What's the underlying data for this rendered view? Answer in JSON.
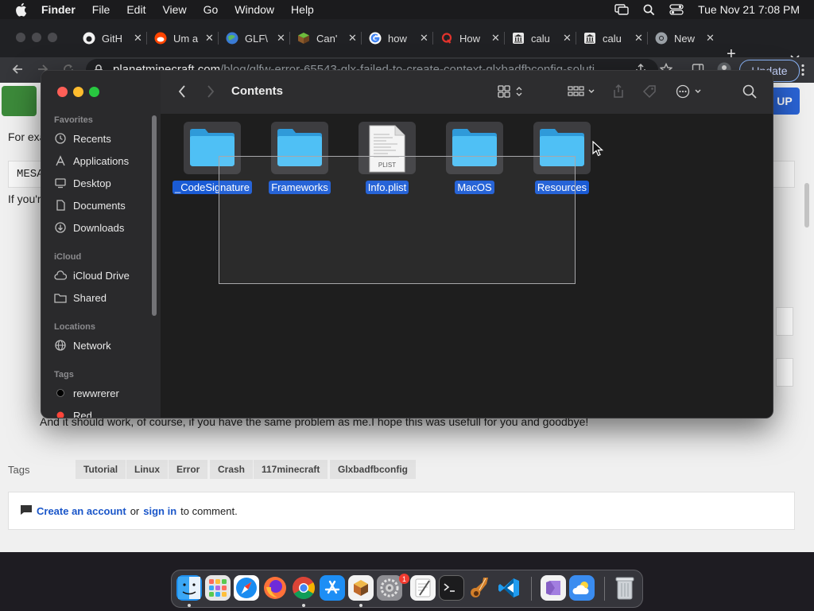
{
  "menubar": {
    "app_name": "Finder",
    "menus": [
      "File",
      "Edit",
      "View",
      "Go",
      "Window",
      "Help"
    ],
    "clock": "Tue Nov 21  7:08 PM"
  },
  "browser": {
    "tabs": [
      {
        "label": "GitH",
        "icon": "github-icon"
      },
      {
        "label": "Um a",
        "icon": "reddit-icon"
      },
      {
        "label": "GLF\\",
        "icon": "globe-icon"
      },
      {
        "label": "Can'",
        "icon": "minecraft-block-icon"
      },
      {
        "label": "how",
        "icon": "google-icon"
      },
      {
        "label": "How",
        "icon": "quora-icon"
      },
      {
        "label": "calu",
        "icon": "bank-icon"
      },
      {
        "label": "calu",
        "icon": "bank-icon"
      },
      {
        "label": "New",
        "icon": "chrome-icon"
      }
    ],
    "url_host": "planetminecraft.com",
    "url_path": "/blog/glfw-error-65543-glx-failed-to-create-context-glxbadfbconfig-soluti",
    "update_label": "Update"
  },
  "webpage": {
    "text_forexa": "For exa",
    "code_snippet": "MESA",
    "text_ifyou": "If you'r",
    "ending_text": "And it should work, of course, if you have the same problem as me.I hope this was usefull for you and goodbye!",
    "signup_label": "UP",
    "tags_label": "Tags",
    "tags": [
      "Tutorial",
      "Linux",
      "Error",
      "Crash",
      "117minecraft",
      "Glxbadfbconfig"
    ],
    "comment": {
      "create_account": "Create an account",
      "or": "or",
      "sign_in": "sign in",
      "suffix": "to comment."
    }
  },
  "finder": {
    "title": "Contents",
    "sidebar": {
      "favorites_heading": "Favorites",
      "favorites": [
        {
          "label": "Recents",
          "icon": "clock-icon"
        },
        {
          "label": "Applications",
          "icon": "applications-icon"
        },
        {
          "label": "Desktop",
          "icon": "desktop-icon"
        },
        {
          "label": "Documents",
          "icon": "document-icon"
        },
        {
          "label": "Downloads",
          "icon": "download-icon"
        }
      ],
      "icloud_heading": "iCloud",
      "icloud": [
        {
          "label": "iCloud Drive",
          "icon": "cloud-icon"
        },
        {
          "label": "Shared",
          "icon": "shared-folder-icon"
        }
      ],
      "locations_heading": "Locations",
      "locations": [
        {
          "label": "Network",
          "icon": "globe-icon"
        }
      ],
      "tags_heading": "Tags",
      "tags": [
        {
          "label": "rewwrerer",
          "color": "#000000"
        },
        {
          "label": "Red",
          "color": "#ff453a"
        }
      ]
    },
    "files": [
      {
        "name": "_CodeSignature",
        "type": "folder"
      },
      {
        "name": "Frameworks",
        "type": "folder"
      },
      {
        "name": "Info.plist",
        "type": "plist",
        "badge": "PLIST"
      },
      {
        "name": "MacOS",
        "type": "folder"
      },
      {
        "name": "Resources",
        "type": "folder"
      }
    ]
  },
  "dock": {
    "apps": [
      "finder-icon",
      "launchpad-icon",
      "safari-icon",
      "firefox-icon",
      "chrome-icon",
      "app-store-icon",
      "cube-app-icon",
      "system-settings-icon",
      "textedit-icon",
      "terminal-icon",
      "garageband-icon",
      "vscode-icon",
      "visual-studio-icon",
      "weather-icon",
      "trash-icon"
    ],
    "settings_badge": "1"
  },
  "colors": {
    "selection": "#1a5bd5",
    "folder": "#3fb4f2",
    "accent_link": "#1a56c9"
  }
}
